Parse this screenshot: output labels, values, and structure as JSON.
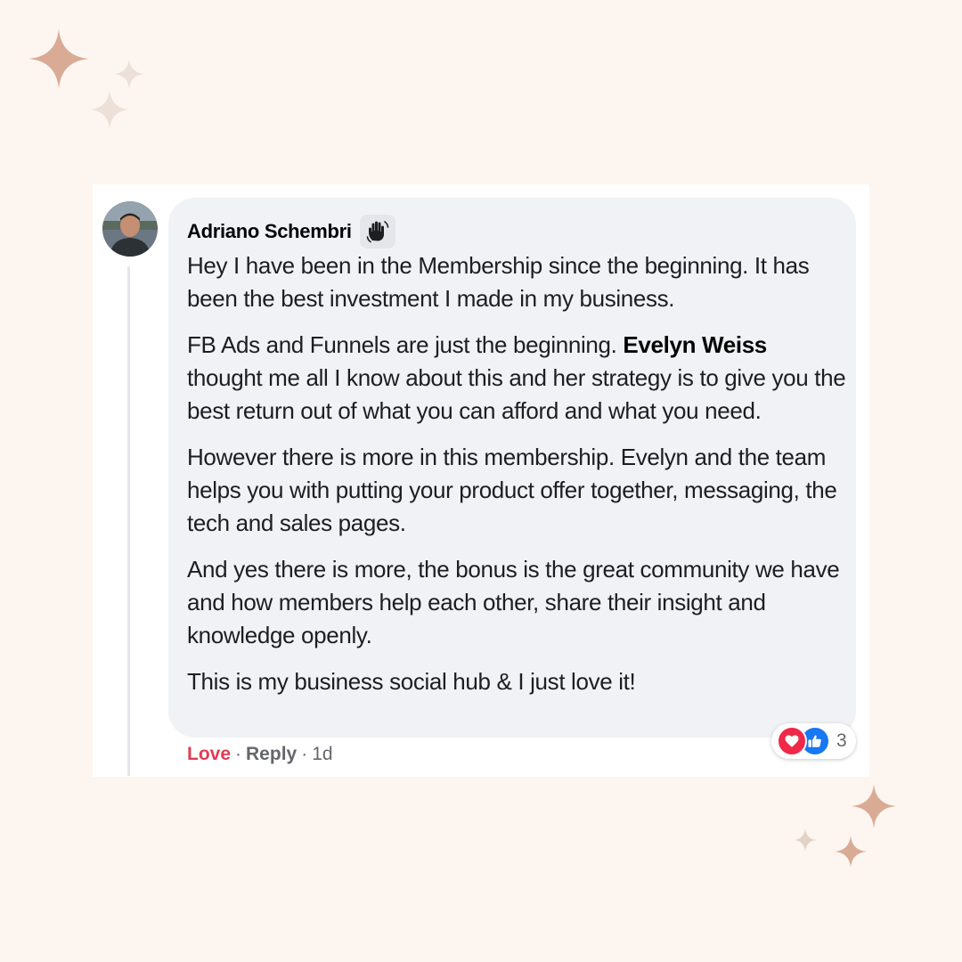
{
  "colors": {
    "background": "#fdf5f0",
    "sparkle_primary": "#d9ab95",
    "sparkle_light": "#ece0d9",
    "card": "#ffffff",
    "bubble": "#f0f2f5",
    "love": "#e33c55",
    "like": "#1877f2"
  },
  "comment": {
    "avatar_icon": "user-avatar-photo",
    "author": "Adriano Schembri",
    "badge_icon": "waving-hand-icon",
    "paragraphs": {
      "p1": "Hey I have been in the Membership since the beginning. It has been the best investment I made in my business.",
      "p2_before": "FB Ads and Funnels are just the beginning. ",
      "p2_mention": "Evelyn Weiss",
      "p2_after": " thought me all I know about this and her strategy is to give you the best return out of what you can afford and what you need.",
      "p3": "However there is more in this membership. Evelyn and the team helps you with putting your product offer together, messaging, the tech and sales pages.",
      "p4": "And yes there is more, the bonus is the great community we have and how members help each other, share their insight and knowledge openly.",
      "p5": "This is my business social hub & I just love it!"
    },
    "actions": {
      "love_label": "Love",
      "reply_label": "Reply",
      "separator": "·",
      "time": "1d"
    },
    "reactions": {
      "icons": [
        "love-reaction-icon",
        "like-reaction-icon"
      ],
      "count": "3"
    }
  }
}
